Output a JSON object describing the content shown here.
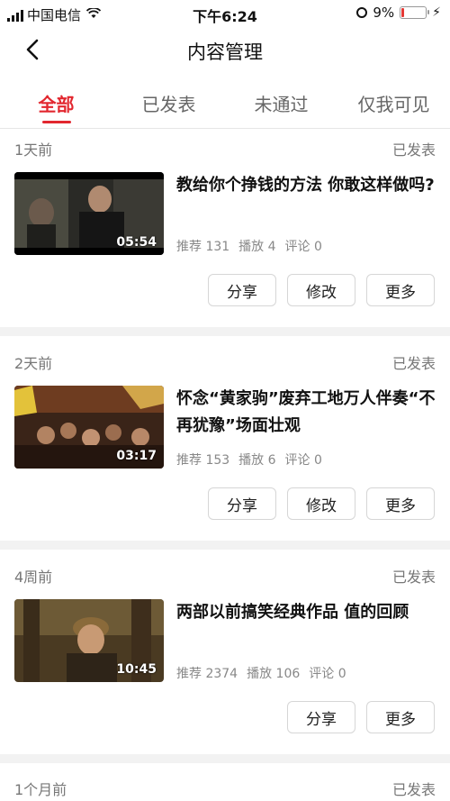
{
  "status_bar": {
    "carrier": "中国电信",
    "time": "下午6:24",
    "battery": "9%"
  },
  "nav": {
    "title": "内容管理"
  },
  "tabs": [
    {
      "label": "全部",
      "active": true
    },
    {
      "label": "已发表",
      "active": false
    },
    {
      "label": "未通过",
      "active": false
    },
    {
      "label": "仅我可见",
      "active": false
    }
  ],
  "items": [
    {
      "ago": "1天前",
      "status": "已发表",
      "title": "教给你个挣钱的方法 你敢这样做吗?",
      "duration": "05:54",
      "recommend": "推荐 131",
      "plays": "播放 4",
      "comments": "评论 0",
      "buttons": [
        "分享",
        "修改",
        "更多"
      ]
    },
    {
      "ago": "2天前",
      "status": "已发表",
      "title": "怀念“黄家驹”废弃工地万人伴奏“不再犹豫”场面壮观",
      "duration": "03:17",
      "recommend": "推荐 153",
      "plays": "播放 6",
      "comments": "评论 0",
      "buttons": [
        "分享",
        "修改",
        "更多"
      ]
    },
    {
      "ago": "4周前",
      "status": "已发表",
      "title": "两部以前搞笑经典作品  值的回顾",
      "duration": "10:45",
      "recommend": "推荐 2374",
      "plays": "播放 106",
      "comments": "评论 0",
      "buttons": [
        "分享",
        "更多"
      ]
    },
    {
      "ago": "1个月前",
      "status": "已发表"
    }
  ],
  "colors": {
    "accent": "#e2272f",
    "battery_low": "#e53935"
  }
}
